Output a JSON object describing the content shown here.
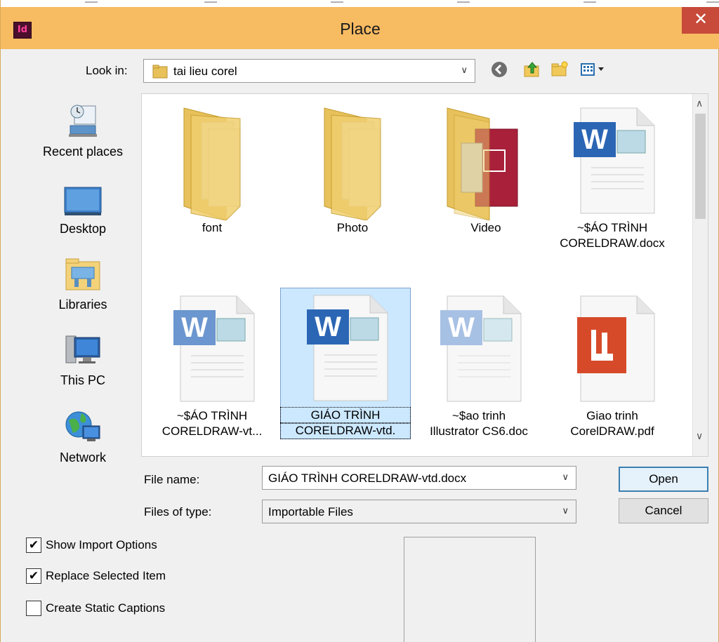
{
  "window": {
    "title": "Place",
    "app_icon_text": "Id",
    "close_glyph": "✕"
  },
  "look_in": {
    "label": "Look in:",
    "value": "tai lieu corel",
    "dropdown_glyph": "∨"
  },
  "toolbar": {
    "icons": [
      "back-icon",
      "up-folder-icon",
      "new-folder-icon",
      "view-menu-icon"
    ]
  },
  "places": [
    {
      "label": "Recent places",
      "icon": "recent-places-icon"
    },
    {
      "label": "Desktop",
      "icon": "desktop-icon"
    },
    {
      "label": "Libraries",
      "icon": "libraries-icon"
    },
    {
      "label": "This PC",
      "icon": "this-pc-icon"
    },
    {
      "label": "Network",
      "icon": "network-icon"
    }
  ],
  "files": [
    {
      "name_line1": "font",
      "name_line2": "",
      "type": "folder"
    },
    {
      "name_line1": "Photo",
      "name_line2": "",
      "type": "folder"
    },
    {
      "name_line1": "Video",
      "name_line2": "",
      "type": "folder-video"
    },
    {
      "name_line1": "~$ÁO TRÌNH",
      "name_line2": "CORELDRAW.docx",
      "type": "word"
    },
    {
      "name_line1": "~$ÁO TRÌNH",
      "name_line2": "CORELDRAW-vt...",
      "type": "word"
    },
    {
      "name_line1": "GIÁO TRÌNH",
      "name_line2": "CORELDRAW-vtd.",
      "type": "word",
      "selected": true
    },
    {
      "name_line1": "~$ao trinh",
      "name_line2": "Illustrator CS6.doc",
      "type": "word-faded"
    },
    {
      "name_line1": "Giao trinh",
      "name_line2": "CorelDRAW.pdf",
      "type": "pdf"
    }
  ],
  "file_name": {
    "label": "File name:",
    "value": "GIÁO TRÌNH CORELDRAW-vtd.docx"
  },
  "files_of_type": {
    "label": "Files of type:",
    "value": "Importable Files"
  },
  "buttons": {
    "open": "Open",
    "cancel": "Cancel"
  },
  "options": [
    {
      "label": "Show Import Options",
      "checked": true
    },
    {
      "label": "Replace Selected Item",
      "checked": true
    },
    {
      "label": "Create Static Captions",
      "checked": false
    }
  ],
  "colors": {
    "titlebar": "#f7bb62",
    "close": "#c74a3a",
    "selection": "#cce8ff"
  }
}
